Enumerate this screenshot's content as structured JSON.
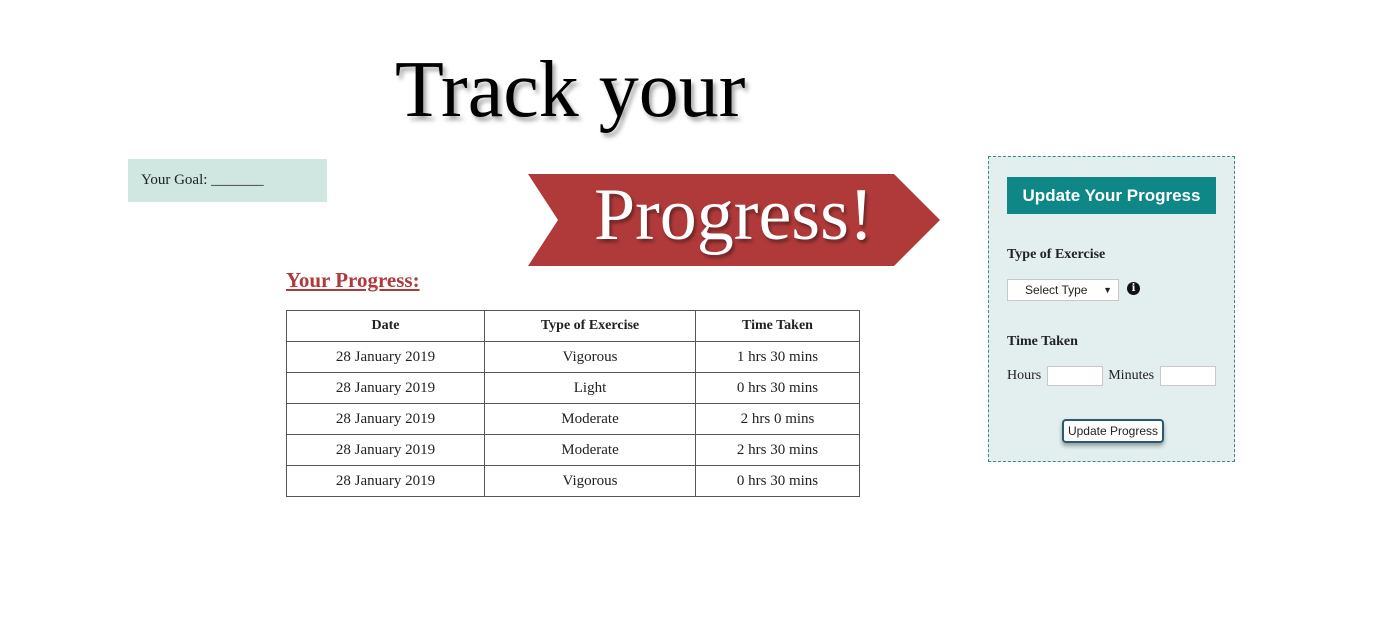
{
  "hero": {
    "line1": "Track your",
    "line2": "Progress!"
  },
  "goal": {
    "label": "Your Goal: _______"
  },
  "progress": {
    "heading": "Your Progress:",
    "columns": [
      "Date",
      "Type of Exercise",
      "Time Taken"
    ],
    "rows": [
      [
        "28 January 2019",
        "Vigorous",
        "1 hrs 30 mins"
      ],
      [
        "28 January 2019",
        "Light",
        "0 hrs 30 mins"
      ],
      [
        "28 January 2019",
        "Moderate",
        "2 hrs 0 mins"
      ],
      [
        "28 January 2019",
        "Moderate",
        "2 hrs 30 mins"
      ],
      [
        "28 January 2019",
        "Vigorous",
        "0 hrs 30 mins"
      ]
    ]
  },
  "update": {
    "title": "Update Your Progress",
    "type_label": "Type of Exercise",
    "type_select": "Select Type",
    "time_label": "Time Taken",
    "hours_label": "Hours",
    "minutes_label": "Minutes",
    "hours_value": "",
    "minutes_value": "",
    "button_label": "Update Progress"
  },
  "icons": {
    "info": "info-icon",
    "dropdown": "chevron-down-icon"
  },
  "colors": {
    "banner": "#b03a3a",
    "heading": "#b03a3a",
    "panel_header": "#0f8787",
    "panel_bg": "#e2efee",
    "goal_bg": "#cfe6e1"
  }
}
